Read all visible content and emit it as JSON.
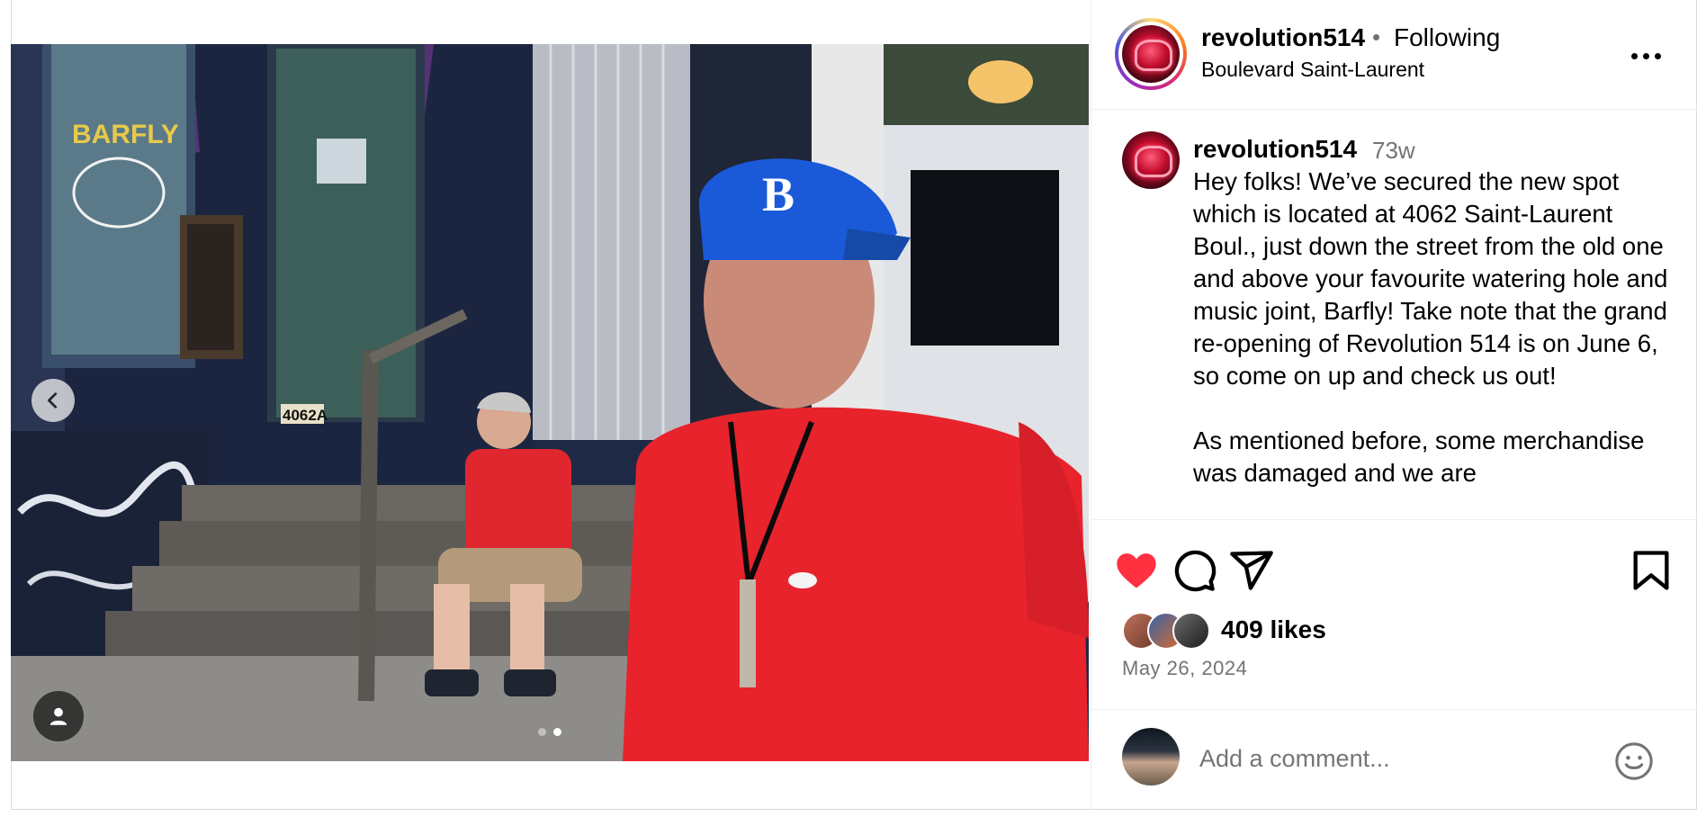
{
  "post": {
    "username": "revolution514",
    "follow_state": "Following",
    "bullet": "•",
    "location": "Boulevard Saint-Laurent"
  },
  "caption": {
    "username": "revolution514",
    "time_ago": "73w",
    "text": "Hey folks! We’ve secured the new spot which is located at 4062 Saint-Laurent Boul., just down the street from the old one and above your favourite watering hole and music joint, Barfly! Take note that the grand re-opening of Revolution 514 is on June 6, so come on up and check us out!\n\nAs mentioned before, some merchandise was damaged and we are"
  },
  "media": {
    "sign_text": "BARFLY",
    "address_number": "4062A",
    "cap_letter": "B",
    "carousel_total": 2,
    "carousel_active": 2
  },
  "actions": {
    "liked": true,
    "like_color": "#ff3040",
    "likes_count_label": "409 likes",
    "date": "May 26, 2024"
  },
  "comment": {
    "placeholder": "Add a comment..."
  },
  "icons": [
    "chevron-left-icon",
    "user-tag-icon",
    "more-icon",
    "heart-icon",
    "comment-icon",
    "share-icon",
    "bookmark-icon",
    "emoji-icon"
  ]
}
